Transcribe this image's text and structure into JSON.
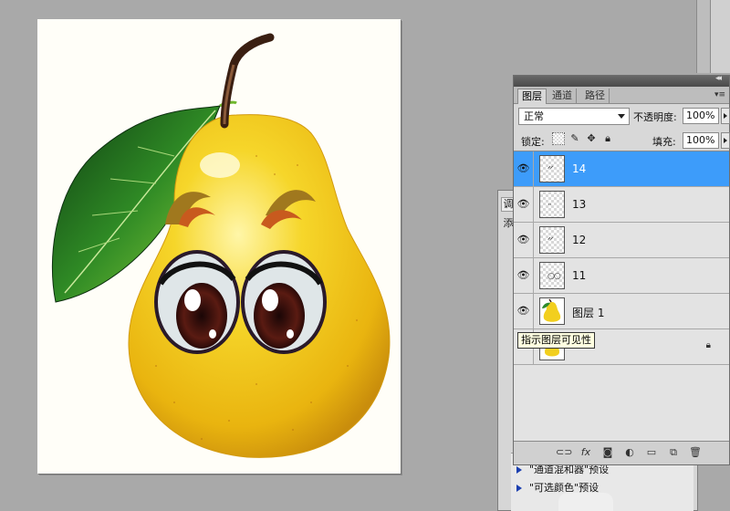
{
  "layers_panel": {
    "tabs": [
      {
        "label": "图层"
      },
      {
        "label": "通道"
      },
      {
        "label": "路径"
      }
    ],
    "collapse_icon": "double-chevron-icon",
    "menu_icon": "panel-menu-icon",
    "blend_mode": "正常",
    "opacity_label": "不透明度:",
    "opacity_value": "100%",
    "lock_label": "锁定:",
    "fill_label": "填充:",
    "fill_value": "100%",
    "layers": [
      {
        "name": "14",
        "visible": true,
        "selected": true
      },
      {
        "name": "13",
        "visible": true,
        "selected": false
      },
      {
        "name": "12",
        "visible": true,
        "selected": false
      },
      {
        "name": "11",
        "visible": true,
        "selected": false
      },
      {
        "name": "图层 1",
        "visible": true,
        "selected": false
      },
      {
        "name": "",
        "visible": false,
        "selected": false,
        "locked": true
      }
    ],
    "tooltip": "指示图层可见性",
    "footer_icons": [
      "link-icon",
      "fx-icon",
      "mask-icon",
      "adjustment-icon",
      "folder-icon",
      "new-layer-icon",
      "trash-icon"
    ]
  },
  "back_panel": {
    "tab1": "调",
    "tab2": "添",
    "presets": [
      {
        "label": "\"通道混和器\"预设"
      },
      {
        "label": "\"可选颜色\"预设"
      }
    ]
  },
  "colors": {
    "selected_layer": "#3d9cfa",
    "pear_yellow": "#f2cf1e",
    "leaf_green": "#2e8b2e"
  }
}
